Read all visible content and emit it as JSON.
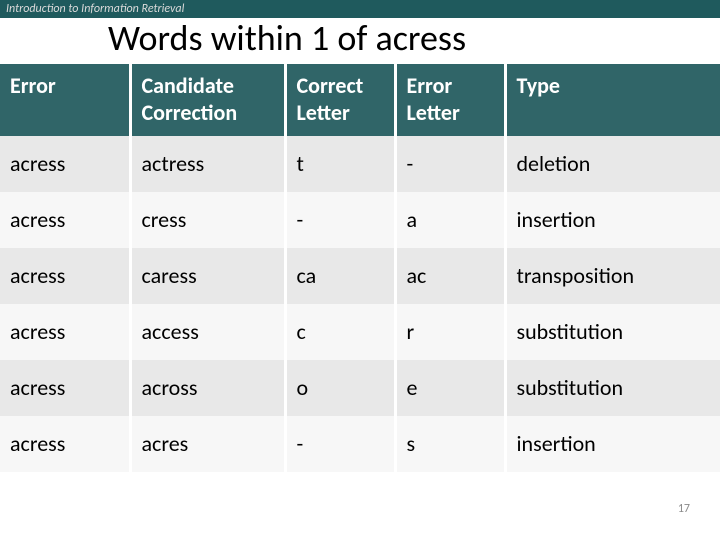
{
  "header": {
    "tagline": "Introduction to Information Retrieval"
  },
  "slide": {
    "title": "Words within 1 of acress",
    "page_number": "17"
  },
  "table": {
    "headers": {
      "error": "Error",
      "candidate": "Candidate Correction",
      "correct_letter": "Correct Letter",
      "error_letter": "Error Letter",
      "type": "Type"
    },
    "rows": [
      {
        "error": "acress",
        "candidate": "actress",
        "correct_letter": "t",
        "error_letter": "-",
        "type": "deletion"
      },
      {
        "error": "acress",
        "candidate": "cress",
        "correct_letter": "-",
        "error_letter": "a",
        "type": "insertion"
      },
      {
        "error": "acress",
        "candidate": "caress",
        "correct_letter": "ca",
        "error_letter": "ac",
        "type": "transposition"
      },
      {
        "error": "acress",
        "candidate": "access",
        "correct_letter": "c",
        "error_letter": "r",
        "type": "substitution"
      },
      {
        "error": "acress",
        "candidate": "across",
        "correct_letter": "o",
        "error_letter": "e",
        "type": "substitution"
      },
      {
        "error": "acress",
        "candidate": "acres",
        "correct_letter": "-",
        "error_letter": "s",
        "type": "insertion"
      }
    ]
  }
}
